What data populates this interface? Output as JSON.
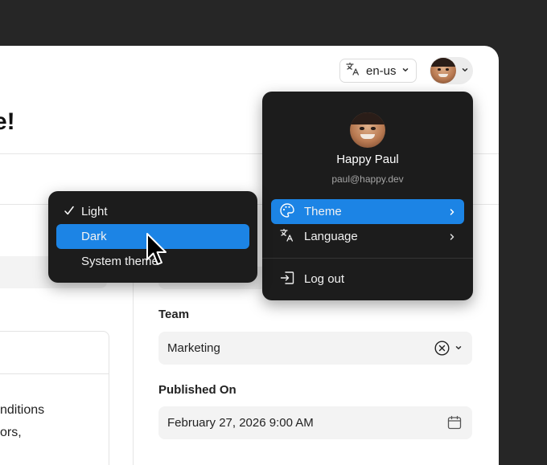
{
  "page": {
    "title": "e!"
  },
  "header": {
    "language_value": "en-us",
    "language_icon": "translate-icon",
    "avatar_icon": "avatar"
  },
  "left": {
    "text_lines": [
      "nditions",
      "ors,"
    ]
  },
  "form": {
    "team_label": "Team",
    "team_value": "Marketing",
    "published_label": "Published On",
    "published_value": "February 27, 2026 9:00 AM"
  },
  "user_menu": {
    "name": "Happy Paul",
    "email": "paul@happy.dev",
    "items": [
      {
        "label": "Theme",
        "icon": "palette-icon",
        "active": true
      },
      {
        "label": "Language",
        "icon": "translate-icon",
        "active": false
      }
    ],
    "logout_label": "Log out"
  },
  "theme_submenu": {
    "items": [
      {
        "label": "Light",
        "checked": true,
        "active": false
      },
      {
        "label": "Dark",
        "checked": false,
        "active": true
      },
      {
        "label": "System theme",
        "checked": false,
        "active": false
      }
    ]
  },
  "colors": {
    "accent": "#1c84e5",
    "menu_bg": "#1c1c1c",
    "backdrop": "#262626",
    "field_bg": "#f3f3f3"
  }
}
